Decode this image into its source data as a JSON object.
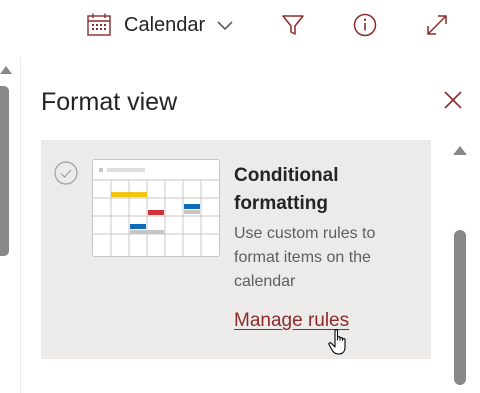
{
  "toolbar": {
    "view_label": "Calendar",
    "view_icon": "calendar-icon",
    "filter_icon": "filter-icon",
    "info_icon": "info-icon",
    "expand_icon": "expand-icon"
  },
  "pane": {
    "title": "Format view",
    "close_icon": "close-icon"
  },
  "card": {
    "title": "Conditional formatting",
    "description": "Use custom rules to format items on the calendar",
    "link_label": "Manage rules"
  },
  "colors": {
    "accent": "#8b2b2b",
    "card_bg": "#edebe9",
    "swatch_yellow": "#f2c40d",
    "swatch_red": "#d13438",
    "swatch_blue": "#0f6cbd",
    "swatch_gray": "#c8c6c4"
  }
}
